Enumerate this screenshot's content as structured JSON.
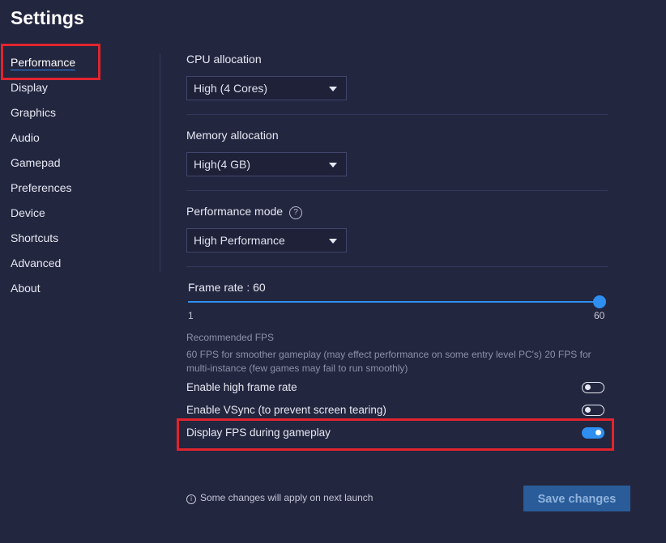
{
  "window": {
    "title": "Settings"
  },
  "sidebar": {
    "items": [
      {
        "label": "Performance",
        "active": true
      },
      {
        "label": "Display"
      },
      {
        "label": "Graphics"
      },
      {
        "label": "Audio"
      },
      {
        "label": "Gamepad"
      },
      {
        "label": "Preferences"
      },
      {
        "label": "Device"
      },
      {
        "label": "Shortcuts"
      },
      {
        "label": "Advanced"
      },
      {
        "label": "About"
      }
    ]
  },
  "cpu": {
    "label": "CPU allocation",
    "value": "High (4 Cores)"
  },
  "memory": {
    "label": "Memory allocation",
    "value": "High(4 GB)"
  },
  "perf_mode": {
    "label": "Performance mode",
    "help_glyph": "?",
    "value": "High Performance"
  },
  "frame_rate": {
    "label": "Frame rate : 60",
    "value": 60,
    "min_label": "1",
    "max_label": "60"
  },
  "recommended": {
    "title": "Recommended FPS",
    "body": "60 FPS for smoother gameplay (may effect performance on some entry level PC's) 20 FPS for multi-instance (few games may fail to run smoothly)"
  },
  "toggles": [
    {
      "label": "Enable high frame rate",
      "on": false
    },
    {
      "label": "Enable VSync (to prevent screen tearing)",
      "on": false
    },
    {
      "label": "Display FPS during gameplay",
      "on": true
    }
  ],
  "footer": {
    "info_glyph": "i",
    "note": "Some changes will apply on next launch",
    "save_label": "Save changes"
  },
  "colors": {
    "background": "#23263f",
    "accent": "#2e8ff0",
    "highlight": "#e1242d",
    "save_button": "#2a5c99"
  }
}
